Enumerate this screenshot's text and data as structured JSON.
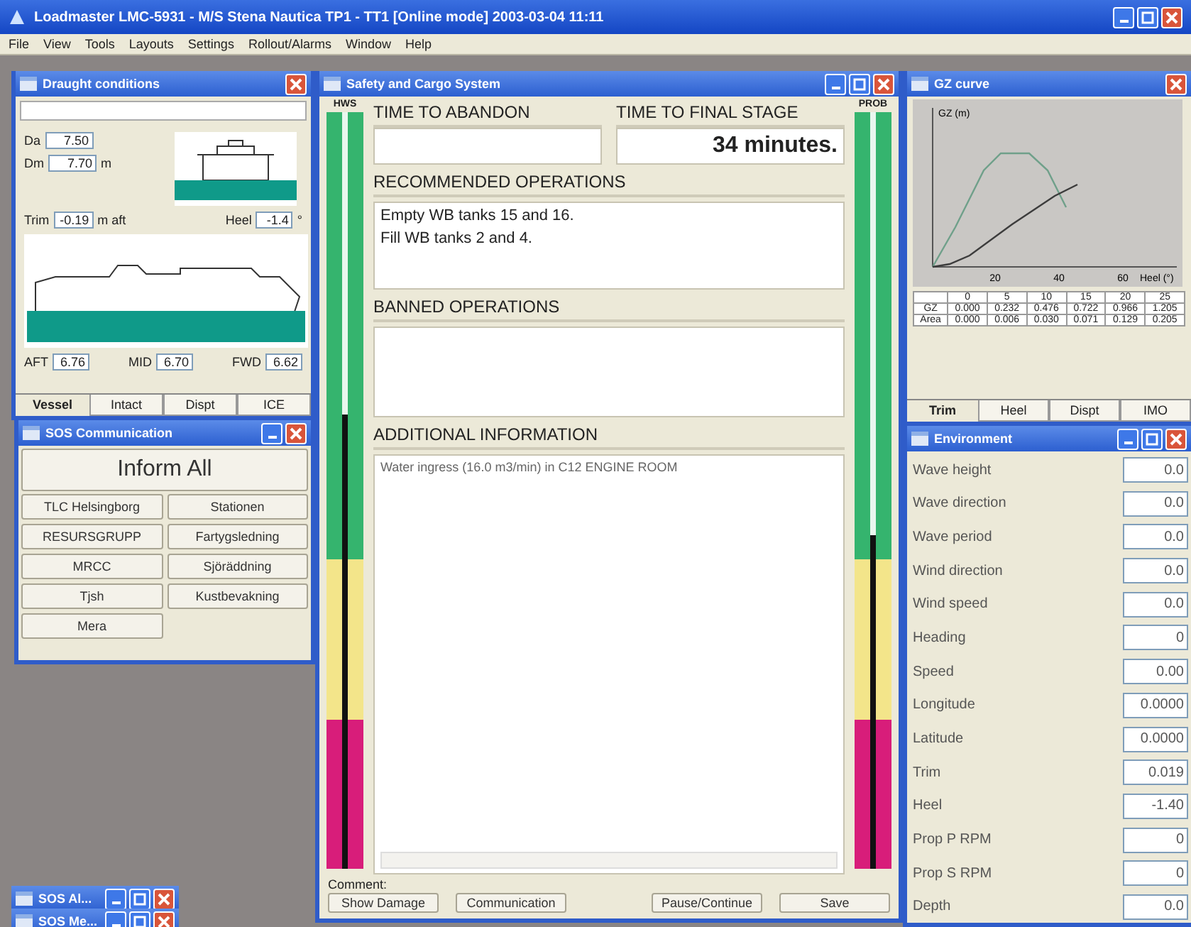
{
  "app_window": {
    "title": "Loadmaster LMC-5931 - M/S Stena Nautica   TP1 - TT1   [Online mode]   2003-03-04 11:11"
  },
  "menu": [
    "File",
    "View",
    "Tools",
    "Layouts",
    "Settings",
    "Rollout/Alarms",
    "Window",
    "Help"
  ],
  "draught_window": {
    "title": "Draught conditions",
    "upper_fields": [
      {
        "label": "Da",
        "value": "7.50"
      },
      {
        "label": "Dm",
        "value": "7.70",
        "unit": "m"
      }
    ],
    "trim": {
      "label": "Trim",
      "value": "-0.19",
      "unit": "m aft"
    },
    "heel": {
      "label": "Heel",
      "value": "-1.4",
      "unit": "°"
    },
    "marks": [
      {
        "label": "AFT",
        "value": "6.76"
      },
      {
        "label": "MID",
        "value": "6.70"
      },
      {
        "label": "FWD",
        "value": "6.62"
      }
    ],
    "tabs": [
      {
        "label": "Vessel",
        "selected": true
      },
      {
        "label": "Intact",
        "selected": false
      },
      {
        "label": "Dispt",
        "selected": false
      },
      {
        "label": "ICE",
        "selected": false
      }
    ]
  },
  "comm_window": {
    "title": "SOS Communication",
    "main_button": "Inform All",
    "buttons": [
      "TLC Helsingborg",
      "Stationen",
      "RESURSGRUPP",
      "Fartygsledning",
      "MRCC",
      "Sjöräddning",
      "Tjsh",
      "Kustbevakning",
      "Mera"
    ]
  },
  "minimized": [
    {
      "title": "SOS Al..."
    },
    {
      "title": "SOS Me..."
    }
  ],
  "safety_window": {
    "title": "Safety and Cargo System",
    "left_gauge": {
      "label": "HWS",
      "level": 0.6
    },
    "right_gauge": {
      "label": "PROB",
      "level": 0.44
    },
    "time_to_abandon": {
      "label": "TIME TO ABANDON"
    },
    "time_to_final": {
      "label": "TIME TO FINAL STAGE",
      "value": "34 minutes."
    },
    "recommended": {
      "label": "RECOMMENDED OPERATIONS",
      "lines": [
        "Empty WB tanks 15 and 16.",
        "Fill WB tanks 2 and 4."
      ]
    },
    "banned": {
      "label": "BANNED OPERATIONS"
    },
    "additional": {
      "label": "ADDITIONAL INFORMATION",
      "lines": [
        "Water ingress (16.0 m3/min) in C12 ENGINE ROOM"
      ]
    },
    "comment_label": "Comment:",
    "buttons": [
      "Show Damage",
      "Communication",
      "Pause/Continue",
      "Save"
    ]
  },
  "chart_window": {
    "title": "GZ curve",
    "chart": {
      "ylabel": "GZ (m)",
      "xlabel": "Heel (°)",
      "tick_labels": [
        "20",
        "40",
        "60"
      ]
    },
    "table": {
      "columns": [
        "0",
        "5",
        "10",
        "15",
        "20",
        "25"
      ],
      "rows": [
        {
          "label": "GZ",
          "cells": [
            "0.000",
            "0.232",
            "0.476",
            "0.722",
            "0.966",
            "1.205"
          ]
        },
        {
          "label": "Area",
          "cells": [
            "0.000",
            "0.006",
            "0.030",
            "0.071",
            "0.129",
            "0.205"
          ]
        }
      ]
    },
    "tabs": [
      {
        "label": "Trim",
        "selected": true
      },
      {
        "label": "Heel",
        "selected": false
      },
      {
        "label": "Dispt",
        "selected": false
      },
      {
        "label": "IMO",
        "selected": false
      }
    ]
  },
  "environment_window": {
    "title": "Environment",
    "rows": [
      {
        "label": "Wave height",
        "value": "0.0"
      },
      {
        "label": "Wave direction",
        "value": "0.0"
      },
      {
        "label": "Wave period",
        "value": "0.0"
      },
      {
        "label": "Wind direction",
        "value": "0.0"
      },
      {
        "label": "Wind speed",
        "value": "0.0"
      },
      {
        "label": "Heading",
        "value": "0"
      },
      {
        "label": "Speed",
        "value": "0.00"
      },
      {
        "label": "Longitude",
        "value": "0.0000"
      },
      {
        "label": "Latitude",
        "value": "0.0000"
      },
      {
        "label": "Trim",
        "value": "0.019"
      },
      {
        "label": "Heel",
        "value": "-1.40"
      },
      {
        "label": "Prop P RPM",
        "value": "0"
      },
      {
        "label": "Prop S RPM",
        "value": "0"
      },
      {
        "label": "Depth",
        "value": "0.0"
      }
    ]
  }
}
